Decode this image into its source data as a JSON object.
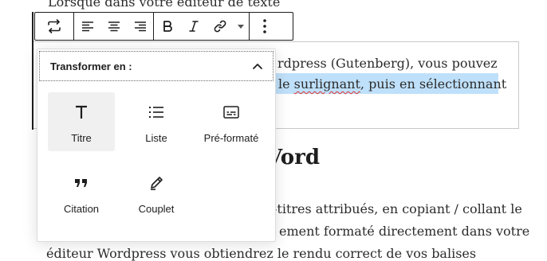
{
  "document": {
    "top_line": "Lorsque dans votre éditeur de texte",
    "para_line1": "rdpress (Gutenberg), vous pouvez",
    "para_line2_a": "le ",
    "para_line2_spell": "surlignant",
    "para_line2_b": ", puis en sélectionnant",
    "heading": "Vord",
    "para3": "-titres attribués, en copiant / collant le",
    "para4": "ement formaté directement dans votre",
    "para5": "éditeur Wordpress vous obtiendrez le rendu correct de vos balises"
  },
  "toolbar": {
    "groups": [
      {
        "items": [
          {
            "icon": "transform-icon"
          }
        ]
      },
      {
        "items": [
          {
            "icon": "align-left-icon"
          },
          {
            "icon": "align-center-icon"
          },
          {
            "icon": "align-right-icon"
          }
        ]
      },
      {
        "items": [
          {
            "icon": "bold-icon"
          },
          {
            "icon": "italic-icon"
          },
          {
            "icon": "link-icon"
          },
          {
            "icon": "more-caret-icon"
          }
        ]
      },
      {
        "items": [
          {
            "icon": "options-icon"
          }
        ]
      }
    ]
  },
  "transform_panel": {
    "title": "Transformer en :",
    "items": [
      {
        "label": "Titre",
        "icon": "heading-icon",
        "active": true
      },
      {
        "label": "Liste",
        "icon": "list-icon",
        "active": false
      },
      {
        "label": "Pré-formaté",
        "icon": "preformatted-icon",
        "active": false
      },
      {
        "label": "Citation",
        "icon": "quote-icon",
        "active": false
      },
      {
        "label": "Couplet",
        "icon": "verse-icon",
        "active": false
      }
    ]
  },
  "colors": {
    "highlight": "#bfe0fa",
    "border_dark": "#1e1e1e",
    "active_bg": "#f0f0f0"
  }
}
